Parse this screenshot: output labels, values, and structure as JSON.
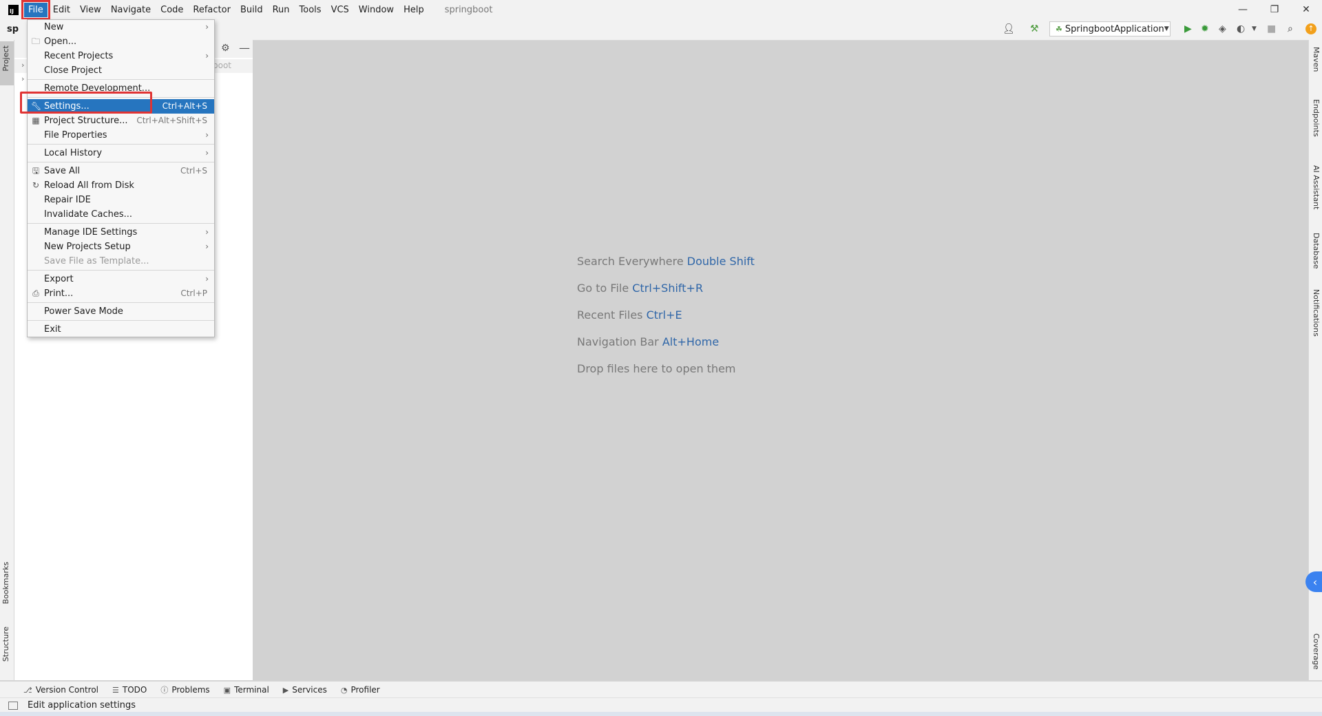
{
  "menubar": {
    "items": [
      "File",
      "Edit",
      "View",
      "Navigate",
      "Code",
      "Refactor",
      "Build",
      "Run",
      "Tools",
      "VCS",
      "Window",
      "Help"
    ],
    "project_name": "springboot"
  },
  "toolbar": {
    "breadcrumb": "sp",
    "run_config": "SpringbootApplication"
  },
  "project_panel": {
    "root_hint": "boot"
  },
  "file_menu": {
    "items": [
      {
        "label": "New",
        "shortcut": "",
        "submenu": true,
        "icon": ""
      },
      {
        "label": "Open...",
        "shortcut": "",
        "submenu": false,
        "icon": "folder-icon"
      },
      {
        "label": "Recent Projects",
        "shortcut": "",
        "submenu": true,
        "icon": ""
      },
      {
        "label": "Close Project",
        "shortcut": "",
        "submenu": false,
        "icon": ""
      },
      {
        "label": "Remote Development...",
        "shortcut": "",
        "submenu": false,
        "icon": ""
      },
      {
        "label": "Settings...",
        "shortcut": "Ctrl+Alt+S",
        "submenu": false,
        "icon": "wrench-icon",
        "selected": true
      },
      {
        "label": "Project Structure...",
        "shortcut": "Ctrl+Alt+Shift+S",
        "submenu": false,
        "icon": "project-structure-icon"
      },
      {
        "label": "File Properties",
        "shortcut": "",
        "submenu": true,
        "icon": ""
      },
      {
        "label": "Local History",
        "shortcut": "",
        "submenu": true,
        "icon": ""
      },
      {
        "label": "Save All",
        "shortcut": "Ctrl+S",
        "submenu": false,
        "icon": "save-icon"
      },
      {
        "label": "Reload All from Disk",
        "shortcut": "",
        "submenu": false,
        "icon": "reload-icon"
      },
      {
        "label": "Repair IDE",
        "shortcut": "",
        "submenu": false,
        "icon": ""
      },
      {
        "label": "Invalidate Caches...",
        "shortcut": "",
        "submenu": false,
        "icon": ""
      },
      {
        "label": "Manage IDE Settings",
        "shortcut": "",
        "submenu": true,
        "icon": ""
      },
      {
        "label": "New Projects Setup",
        "shortcut": "",
        "submenu": true,
        "icon": ""
      },
      {
        "label": "Save File as Template...",
        "shortcut": "",
        "submenu": false,
        "icon": "",
        "disabled": true
      },
      {
        "label": "Export",
        "shortcut": "",
        "submenu": true,
        "icon": ""
      },
      {
        "label": "Print...",
        "shortcut": "Ctrl+P",
        "submenu": false,
        "icon": "print-icon"
      },
      {
        "label": "Power Save Mode",
        "shortcut": "",
        "submenu": false,
        "icon": ""
      },
      {
        "label": "Exit",
        "shortcut": "",
        "submenu": false,
        "icon": ""
      }
    ]
  },
  "editor_hints": [
    {
      "text": "Search Everywhere",
      "shortcut": "Double Shift"
    },
    {
      "text": "Go to File",
      "shortcut": "Ctrl+Shift+R"
    },
    {
      "text": "Recent Files",
      "shortcut": "Ctrl+E"
    },
    {
      "text": "Navigation Bar",
      "shortcut": "Alt+Home"
    },
    {
      "text": "Drop files here to open them",
      "shortcut": ""
    }
  ],
  "left_tabs": [
    "Project",
    "Bookmarks",
    "Structure"
  ],
  "right_tabs": [
    "Maven",
    "Endpoints",
    "AI Assistant",
    "Database",
    "Notifications",
    "Coverage"
  ],
  "bottom_tabs": [
    "Version Control",
    "TODO",
    "Problems",
    "Terminal",
    "Services",
    "Profiler"
  ],
  "status": {
    "message": "Edit application settings"
  },
  "colors": {
    "accent": "#2675bf",
    "highlight_box": "#e03434",
    "shortcut_text": "#2f66a8"
  }
}
